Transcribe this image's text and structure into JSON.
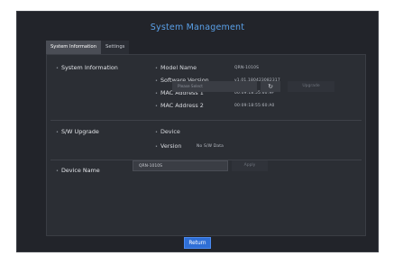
{
  "window": {
    "title": "System Management"
  },
  "tabs": [
    {
      "label": "System Information"
    },
    {
      "label": "Settings"
    }
  ],
  "system_info": {
    "section_label": "System Information",
    "fields": [
      {
        "label": "Model Name",
        "value": "QRN-1010S"
      },
      {
        "label": "Software Version",
        "value": "v1.01.180423082317"
      },
      {
        "label": "MAC Address 1",
        "value": "00:09:18:55:60:9F"
      },
      {
        "label": "MAC Address 2",
        "value": "00:09:18:55:60:A0"
      }
    ]
  },
  "sw_upgrade": {
    "section_label": "S/W Upgrade",
    "device_label": "Device",
    "device_placeholder": "Please Select",
    "upgrade_label": "Upgrade",
    "version_label": "Version",
    "version_value": "No S/W Data"
  },
  "device_name": {
    "section_label": "Device Name",
    "value": "QRN-1010S",
    "apply_label": "Apply"
  },
  "footer": {
    "return_label": "Return"
  },
  "colors": {
    "accent_blue": "#2f6fd6",
    "title_blue": "#5aa0e8",
    "background": "#22242a",
    "panel": "#2b2e34"
  },
  "icons": {
    "refresh": "refresh-icon"
  }
}
